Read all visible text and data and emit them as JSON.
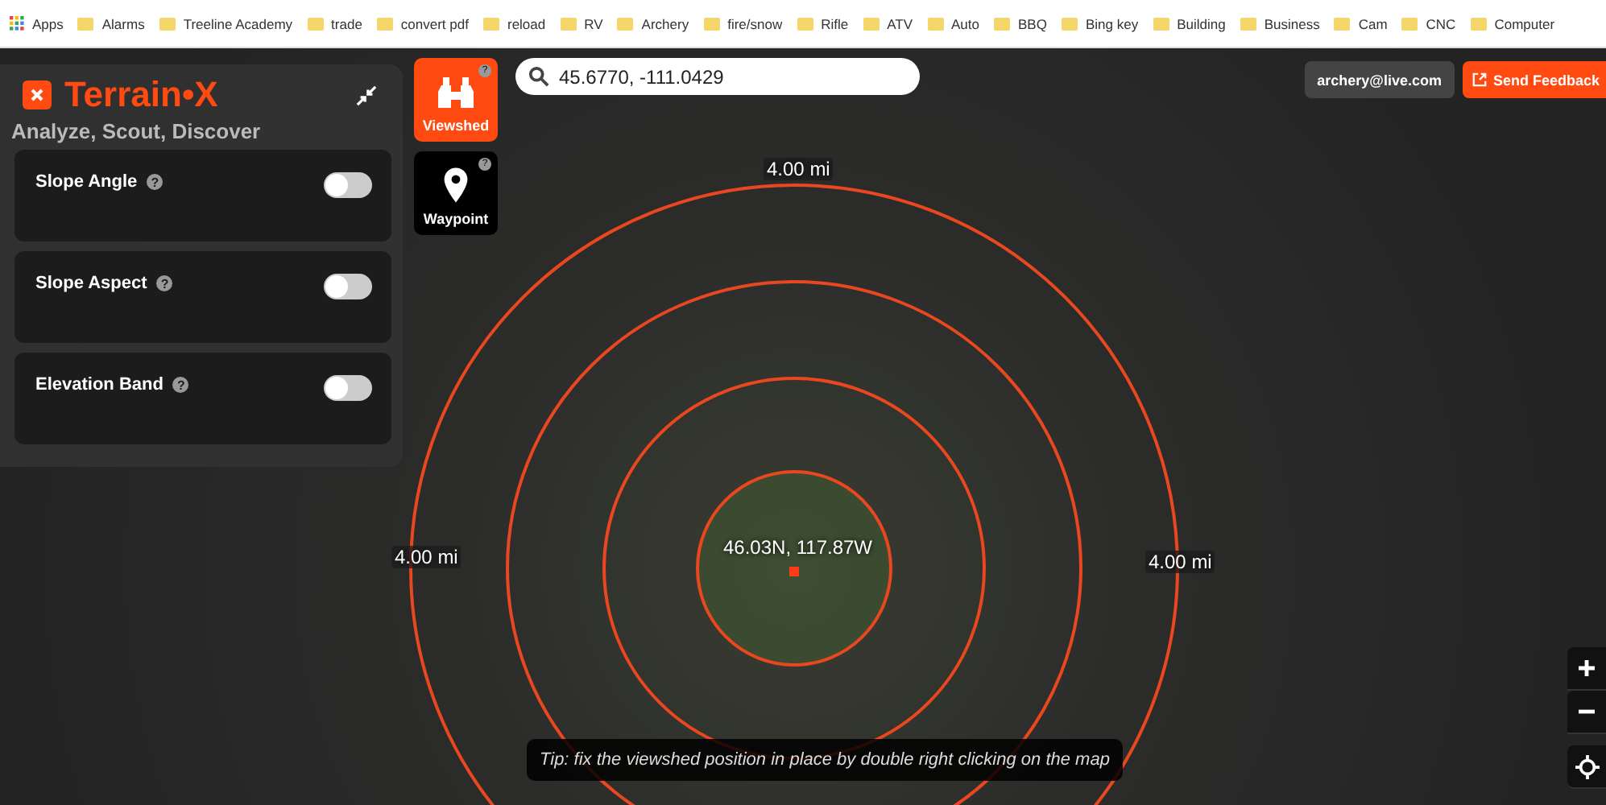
{
  "bookmarks_bar": {
    "apps_label": "Apps",
    "bookmarks": [
      "Alarms",
      "Treeline Academy",
      "trade",
      "convert pdf",
      "reload",
      "RV",
      "Archery",
      "fire/snow",
      "Rifle",
      "ATV",
      "Auto",
      "BBQ",
      "Bing key",
      "Building",
      "Business",
      "Cam",
      "CNC",
      "Computer"
    ]
  },
  "help_glyph": "?",
  "panel": {
    "title": "Terrain•X",
    "subtitle": "Analyze, Scout, Discover",
    "layers": [
      {
        "label": "Slope Angle",
        "on": false
      },
      {
        "label": "Slope Aspect",
        "on": false
      },
      {
        "label": "Elevation Band",
        "on": false
      }
    ]
  },
  "tools": [
    {
      "kind": "binoculars",
      "label": "Viewshed",
      "selected": true
    },
    {
      "kind": "pin",
      "label": "Waypoint",
      "selected": false
    }
  ],
  "search": {
    "value": "45.6770, -111.0429"
  },
  "account": "archery@live.com",
  "feedback_button": "Send Feedback",
  "map": {
    "ring_labels": [
      "4.00 mi",
      "4.00 mi",
      "4.00 mi"
    ],
    "center_label": "46.03N, 117.87W",
    "tip": "Tip: fix the viewshed position in place by double right clicking on the map"
  }
}
